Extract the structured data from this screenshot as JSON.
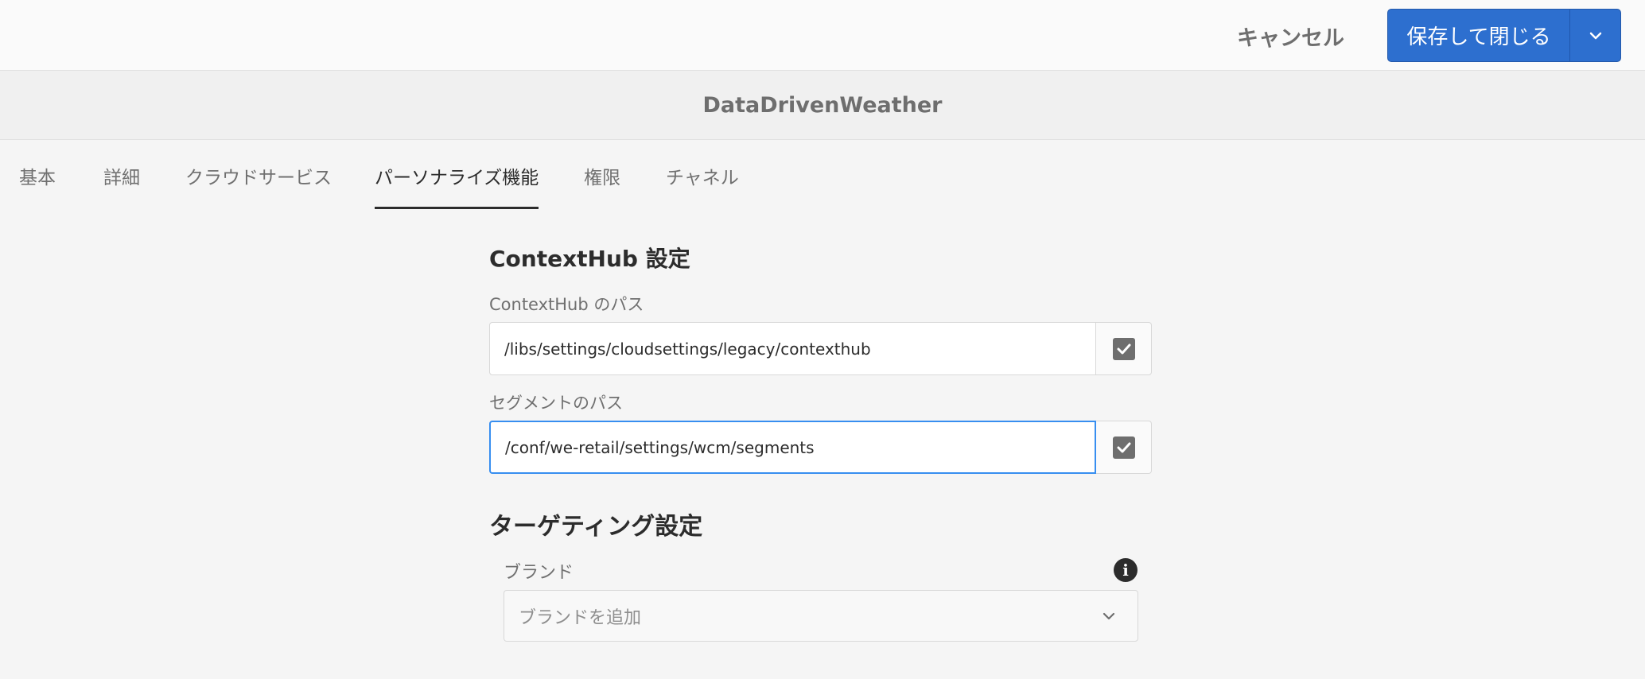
{
  "toolbar": {
    "cancel_label": "キャンセル",
    "save_label": "保存して閉じる"
  },
  "header": {
    "title": "DataDrivenWeather"
  },
  "tabs": [
    {
      "label": "基本"
    },
    {
      "label": "詳細"
    },
    {
      "label": "クラウドサービス"
    },
    {
      "label": "パーソナライズ機能",
      "active": true
    },
    {
      "label": "権限"
    },
    {
      "label": "チャネル"
    }
  ],
  "contexthub": {
    "section_title": "ContextHub 設定",
    "path_label": "ContextHub のパス",
    "path_value": "/libs/settings/cloudsettings/legacy/contexthub",
    "segments_label": "セグメントのパス",
    "segments_value": "/conf/we-retail/settings/wcm/segments"
  },
  "targeting": {
    "section_title": "ターゲティング設定",
    "brand_label": "ブランド",
    "brand_placeholder": "ブランドを追加"
  },
  "colors": {
    "primary": "#2d6fcf",
    "focus": "#378ef0",
    "background": "#f5f5f5"
  },
  "icons": {
    "save_toggle": "chevron-down-icon",
    "picker": "checkbox-icon",
    "info": "info-icon",
    "select": "chevron-down-icon"
  }
}
